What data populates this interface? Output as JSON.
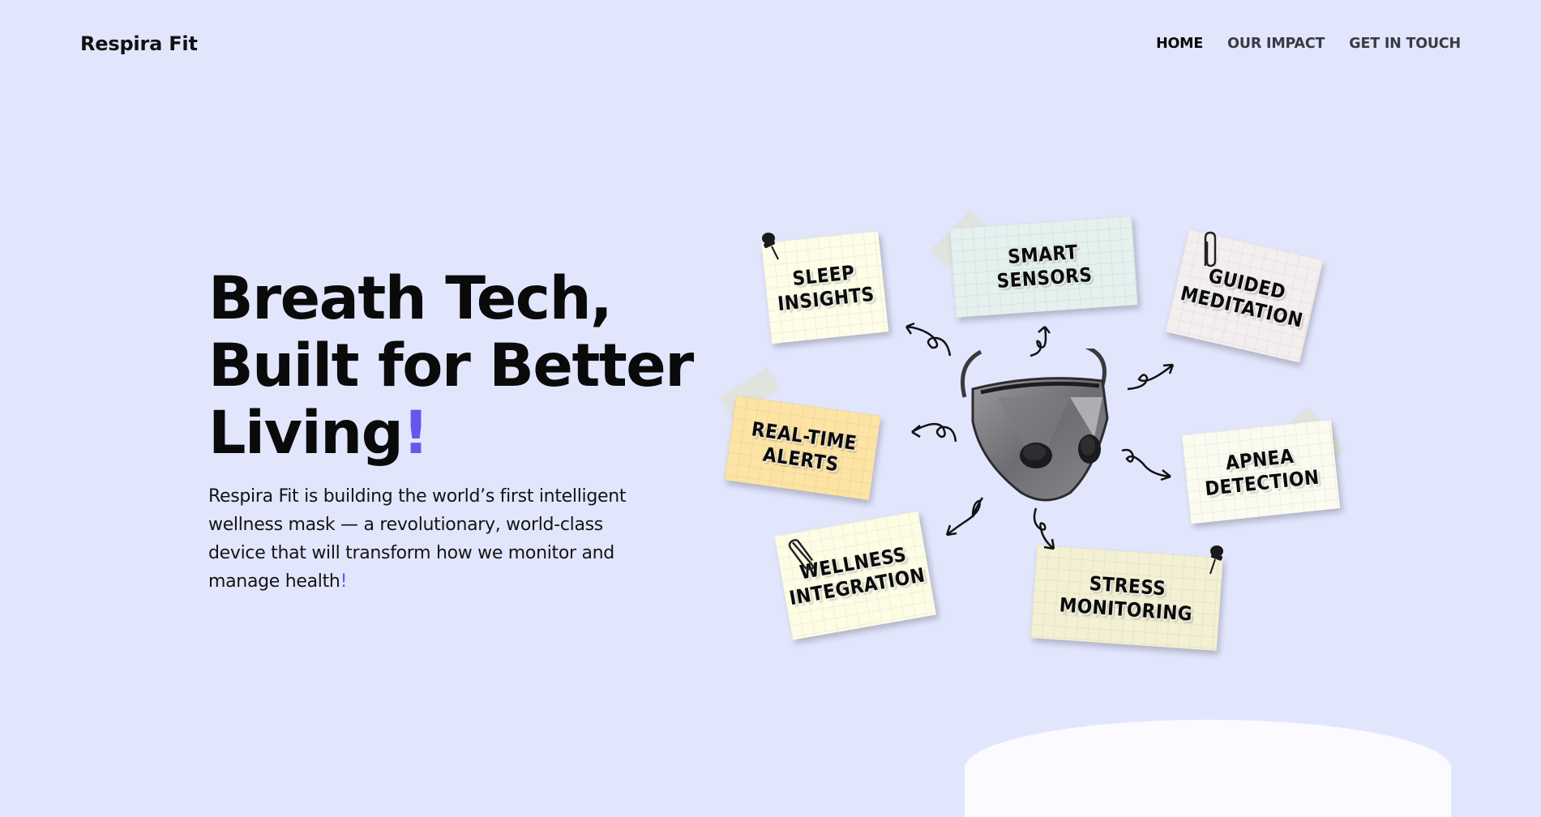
{
  "brand": {
    "name": "Respira Fit"
  },
  "nav": {
    "home": "HOME",
    "impact": "OUR IMPACT",
    "contact": "GET IN TOUCH"
  },
  "hero": {
    "title_line1": "Breath Tech,",
    "title_line2": "Built for Better",
    "title_line3": "Living",
    "title_accent": "!",
    "description": "Respira Fit is building the world’s first intelligent wellness mask — a revolutionary, world-class device that will transform how we monitor and manage health",
    "description_accent": "!"
  },
  "features": {
    "sleep": {
      "line1": "SLEEP",
      "line2": "INSIGHTS",
      "color": "#fdfde8"
    },
    "smart": {
      "line1": "SMART",
      "line2": "SENSORS",
      "color": "#e4f1ee"
    },
    "guided": {
      "line1": "GUIDED",
      "line2": "MEDITATION",
      "color": "#f4efee"
    },
    "alerts": {
      "line1": "REAL-TIME",
      "line2": "ALERTS",
      "color": "#fde4a4"
    },
    "apnea": {
      "line1": "APNEA",
      "line2": "DETECTION",
      "color": "#fbfbf0"
    },
    "wellness": {
      "line1": "WELLNESS",
      "line2": "INTEGRATION",
      "color": "#fdfde6"
    },
    "stress": {
      "line1": "STRESS",
      "line2": "MONITORING",
      "color": "#f4f0d4"
    }
  },
  "colors": {
    "background": "#e2e6fd",
    "accent": "#6a55ea",
    "text": "#0a0a0a"
  },
  "icons": {
    "pin": "push-pin-icon",
    "clip": "paperclip-icon",
    "arrow": "curly-arrow-icon",
    "mask": "wellness-mask-image"
  }
}
